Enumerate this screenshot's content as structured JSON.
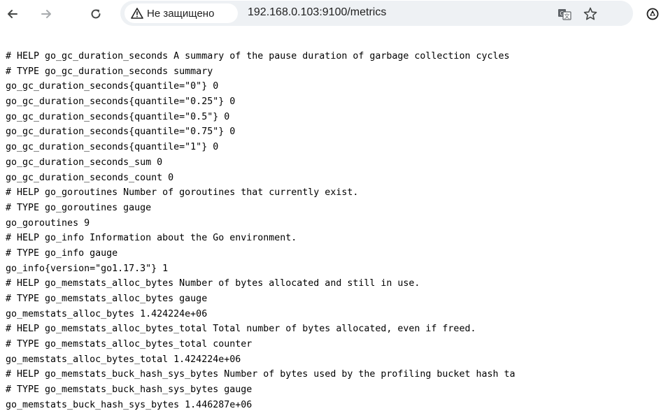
{
  "browser": {
    "security_label": "Не защищено",
    "url": "192.168.0.103:9100/metrics",
    "icons": [
      "back-arrow-icon",
      "forward-arrow-icon",
      "reload-icon",
      "warning-triangle-icon",
      "translate-icon",
      "star-bookmark-icon",
      "extension-icon"
    ]
  },
  "page": {
    "lines": [
      "# HELP go_gc_duration_seconds A summary of the pause duration of garbage collection cycles",
      "# TYPE go_gc_duration_seconds summary",
      "go_gc_duration_seconds{quantile=\"0\"} 0",
      "go_gc_duration_seconds{quantile=\"0.25\"} 0",
      "go_gc_duration_seconds{quantile=\"0.5\"} 0",
      "go_gc_duration_seconds{quantile=\"0.75\"} 0",
      "go_gc_duration_seconds{quantile=\"1\"} 0",
      "go_gc_duration_seconds_sum 0",
      "go_gc_duration_seconds_count 0",
      "# HELP go_goroutines Number of goroutines that currently exist.",
      "# TYPE go_goroutines gauge",
      "go_goroutines 9",
      "# HELP go_info Information about the Go environment.",
      "# TYPE go_info gauge",
      "go_info{version=\"go1.17.3\"} 1",
      "# HELP go_memstats_alloc_bytes Number of bytes allocated and still in use.",
      "# TYPE go_memstats_alloc_bytes gauge",
      "go_memstats_alloc_bytes 1.424224e+06",
      "# HELP go_memstats_alloc_bytes_total Total number of bytes allocated, even if freed.",
      "# TYPE go_memstats_alloc_bytes_total counter",
      "go_memstats_alloc_bytes_total 1.424224e+06",
      "# HELP go_memstats_buck_hash_sys_bytes Number of bytes used by the profiling bucket hash ta",
      "# TYPE go_memstats_buck_hash_sys_bytes gauge",
      "go_memstats_buck_hash_sys_bytes 1.446287e+06"
    ]
  }
}
